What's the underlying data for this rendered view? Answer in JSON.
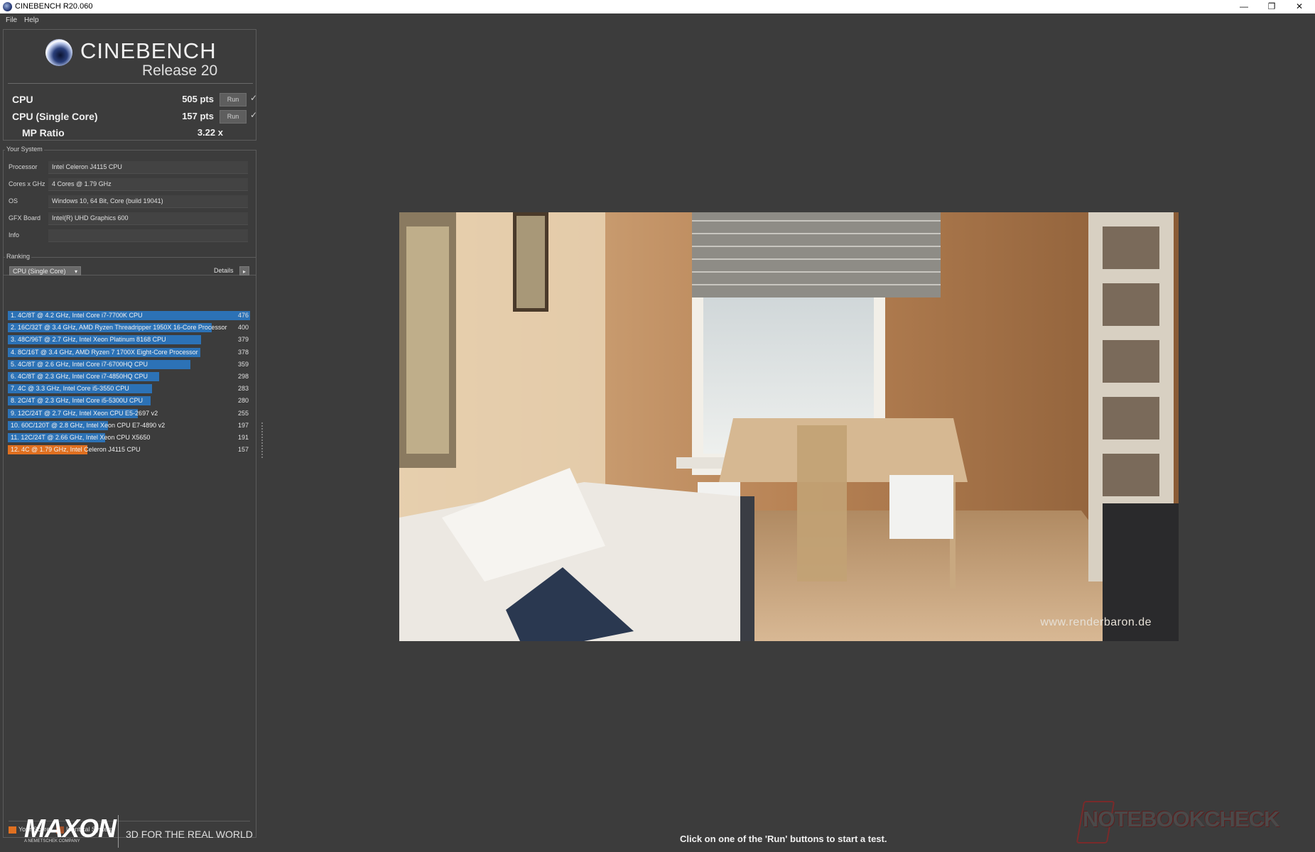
{
  "window": {
    "title": "CINEBENCH R20.060",
    "minimize": "—",
    "restore": "❐",
    "close": "✕"
  },
  "menu": {
    "file": "File",
    "help": "Help"
  },
  "logo": {
    "name": "CINEBENCH",
    "release": "Release 20"
  },
  "scores": [
    {
      "label": "CPU",
      "value": "505 pts",
      "button": "Run",
      "check": "✓"
    },
    {
      "label": "CPU (Single Core)",
      "value": "157 pts",
      "button": "Run",
      "check": "✓"
    },
    {
      "label": "MP Ratio",
      "value": "3.22 x"
    }
  ],
  "system": {
    "title": "Your System",
    "rows": [
      {
        "label": "Processor",
        "value": "Intel Celeron J4115 CPU"
      },
      {
        "label": "Cores x GHz",
        "value": "4 Cores @ 1.79 GHz"
      },
      {
        "label": "OS",
        "value": "Windows 10, 64 Bit, Core (build 19041)"
      },
      {
        "label": "GFX Board",
        "value": "Intel(R) UHD Graphics 600"
      },
      {
        "label": "Info",
        "value": ""
      }
    ]
  },
  "ranking": {
    "title": "Ranking",
    "dropdown": "CPU (Single Core)",
    "details": "Details",
    "max_score": 476,
    "rows": [
      {
        "label": "1. 4C/8T @ 4.2 GHz, Intel Core i7-7700K CPU",
        "score": 476,
        "mine": false
      },
      {
        "label": "2. 16C/32T @ 3.4 GHz, AMD Ryzen Threadripper 1950X 16-Core Processor",
        "score": 400,
        "mine": false
      },
      {
        "label": "3. 48C/96T @ 2.7 GHz, Intel Xeon Platinum 8168 CPU",
        "score": 379,
        "mine": false
      },
      {
        "label": "4. 8C/16T @ 3.4 GHz, AMD Ryzen 7 1700X Eight-Core Processor",
        "score": 378,
        "mine": false
      },
      {
        "label": "5. 4C/8T @ 2.6 GHz, Intel Core i7-6700HQ CPU",
        "score": 359,
        "mine": false
      },
      {
        "label": "6. 4C/8T @ 2.3 GHz, Intel Core i7-4850HQ CPU",
        "score": 298,
        "mine": false
      },
      {
        "label": "7. 4C @ 3.3 GHz, Intel Core i5-3550 CPU",
        "score": 283,
        "mine": false
      },
      {
        "label": "8. 2C/4T @ 2.3 GHz, Intel Core i5-5300U CPU",
        "score": 280,
        "mine": false
      },
      {
        "label": "9. 12C/24T @ 2.7 GHz, Intel Xeon CPU E5-2697 v2",
        "score": 255,
        "mine": false
      },
      {
        "label": "10. 60C/120T @ 2.8 GHz, Intel Xeon CPU E7-4890 v2",
        "score": 197,
        "mine": false
      },
      {
        "label": "11. 12C/24T @ 2.66 GHz, Intel Xeon CPU X5650",
        "score": 191,
        "mine": false
      },
      {
        "label": "12. 4C @ 1.79 GHz, Intel Celeron J4115 CPU",
        "score": 157,
        "mine": true
      }
    ]
  },
  "legend": {
    "your_score": "Your Score",
    "identical": "Identical System",
    "your_color": "#e07020",
    "identical_color": "#a0502a"
  },
  "footer": {
    "brand": "MAXON",
    "brand_sub": "A NEMETSCHEK COMPANY",
    "tagline": "3D FOR THE REAL WORLD",
    "status": "Click on one of the 'Run' buttons to start a test.",
    "watermark": "NOTEBOOKCHECK"
  },
  "render": {
    "credit": "www.renderbaron.de"
  }
}
